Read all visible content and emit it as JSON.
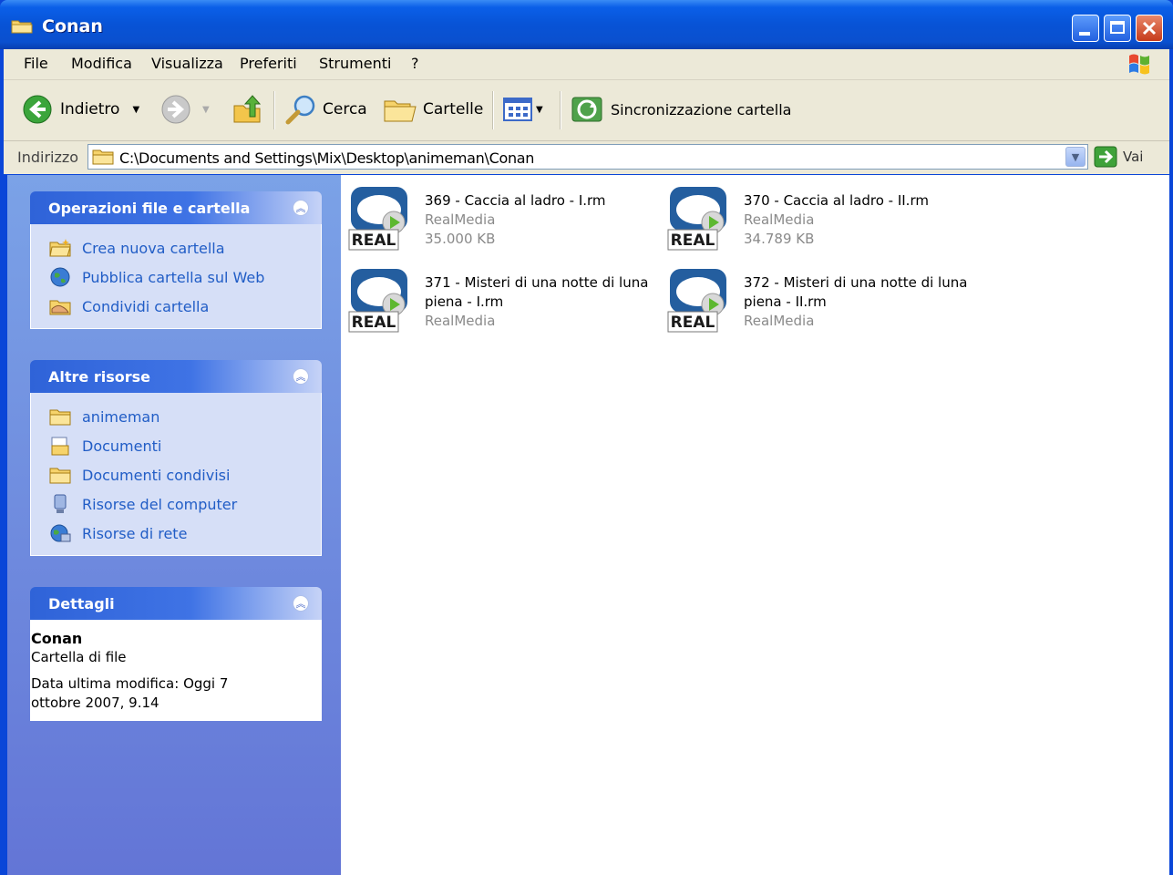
{
  "window": {
    "title": "Conan"
  },
  "menu": [
    "File",
    "Modifica",
    "Visualizza",
    "Preferiti",
    "Strumenti",
    "?"
  ],
  "toolbar": {
    "back": "Indietro",
    "search": "Cerca",
    "folders": "Cartelle",
    "sync": "Sincronizzazione cartella"
  },
  "address": {
    "label": "Indirizzo",
    "path": "C:\\Documents and Settings\\Mix\\Desktop\\animeman\\Conan",
    "go": "Vai"
  },
  "panels": {
    "file_tasks": {
      "title": "Operazioni file e cartella",
      "items": [
        "Crea nuova cartella",
        "Pubblica cartella sul Web",
        "Condividi cartella"
      ]
    },
    "other_places": {
      "title": "Altre risorse",
      "items": [
        "animeman",
        "Documenti",
        "Documenti condivisi",
        "Risorse del computer",
        "Risorse di rete"
      ]
    },
    "details": {
      "title": "Dettagli",
      "name": "Conan",
      "type": "Cartella di file",
      "modified": "Data ultima modifica: Oggi 7 ottobre 2007, 9.14"
    }
  },
  "files": [
    {
      "name": "369 - Caccia al ladro - I.rm",
      "type": "RealMedia",
      "size": "35.000 KB"
    },
    {
      "name": "370 - Caccia al ladro - II.rm",
      "type": "RealMedia",
      "size": "34.789 KB"
    },
    {
      "name": "371 - Misteri di una notte di luna piena - I.rm",
      "type": "RealMedia",
      "size": ""
    },
    {
      "name": "372 - Misteri di una notte di luna piena - II.rm",
      "type": "RealMedia",
      "size": ""
    }
  ],
  "icon_label": "REAL"
}
